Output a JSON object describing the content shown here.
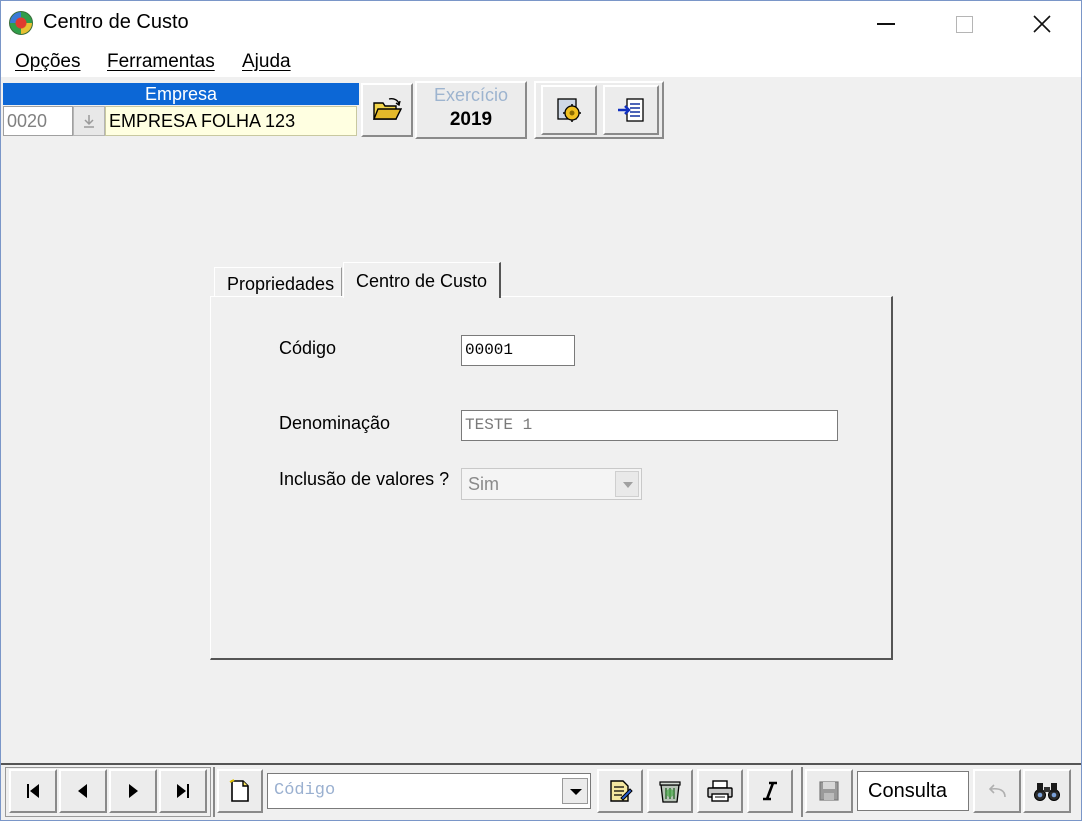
{
  "window": {
    "title": "Centro de Custo"
  },
  "menu": {
    "items": [
      "Opções",
      "Ferramentas",
      "Ajuda"
    ]
  },
  "empresa": {
    "header": "Empresa",
    "code": "0020",
    "name": "EMPRESA FOLHA 123"
  },
  "exercicio": {
    "label": "Exercício",
    "year": "2019"
  },
  "tabs": [
    {
      "label": "Propriedades",
      "active": false
    },
    {
      "label": "Centro de Custo",
      "active": true
    }
  ],
  "form": {
    "codigo_label": "Código",
    "codigo_value": "00001",
    "denominacao_label": "Denominação",
    "denominacao_value": "TESTE 1",
    "inclusao_label": "Inclusão de valores ?",
    "inclusao_value": "Sim"
  },
  "bottom": {
    "search_placeholder": "Código",
    "mode": "Consulta"
  },
  "icons": [
    "app-icon",
    "minimize-icon",
    "maximize-icon",
    "close-icon",
    "dropdown-arrow-icon",
    "open-folder-icon",
    "settings-icon",
    "exit-icon",
    "first-record-icon",
    "previous-record-icon",
    "next-record-icon",
    "last-record-icon",
    "new-document-icon",
    "edit-document-icon",
    "delete-icon",
    "print-icon",
    "italic-icon",
    "save-icon",
    "undo-icon",
    "binoculars-icon"
  ]
}
